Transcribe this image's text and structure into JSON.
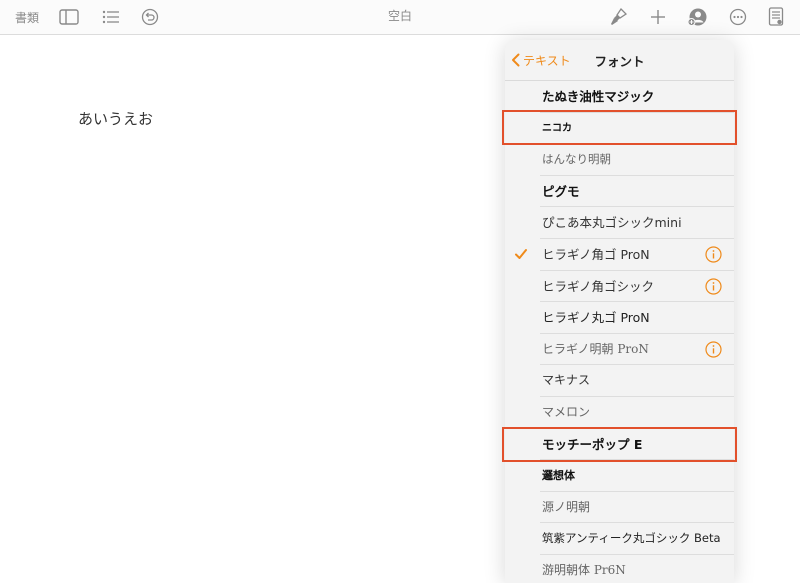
{
  "toolbar": {
    "documents_label": "書類",
    "doc_title": "空白"
  },
  "document": {
    "body_text": "あいうえお"
  },
  "popover": {
    "back_label": "テキスト",
    "title": "フォント",
    "fonts": [
      {
        "name": "たぬき油性マジック",
        "checked": false,
        "info": false
      },
      {
        "name": "ニコカ",
        "checked": false,
        "info": false,
        "highlighted": true
      },
      {
        "name": "はんなり明朝",
        "checked": false,
        "info": false
      },
      {
        "name": "ピグモ",
        "checked": false,
        "info": false
      },
      {
        "name": "ぴこあ本丸ゴシックmini",
        "checked": false,
        "info": false
      },
      {
        "name": "ヒラギノ角ゴ ProN",
        "checked": true,
        "info": true
      },
      {
        "name": "ヒラギノ角ゴシック",
        "checked": false,
        "info": true
      },
      {
        "name": "ヒラギノ丸ゴ ProN",
        "checked": false,
        "info": false
      },
      {
        "name": "ヒラギノ明朝 ProN",
        "checked": false,
        "info": true
      },
      {
        "name": "マキナス",
        "checked": false,
        "info": false
      },
      {
        "name": "マメロン",
        "checked": false,
        "info": false
      },
      {
        "name": "モッチーポップ E",
        "checked": false,
        "info": false,
        "highlighted": true
      },
      {
        "name": "邏想体",
        "checked": false,
        "info": false
      },
      {
        "name": "源ノ明朝",
        "checked": false,
        "info": false
      },
      {
        "name": "筑紫アンティーク丸ゴシック Beta",
        "checked": false,
        "info": false
      },
      {
        "name": "游明朝体 Pr6N",
        "checked": false,
        "info": false
      }
    ]
  },
  "colors": {
    "accent": "#ef8a1a",
    "highlight": "#e2502b"
  }
}
